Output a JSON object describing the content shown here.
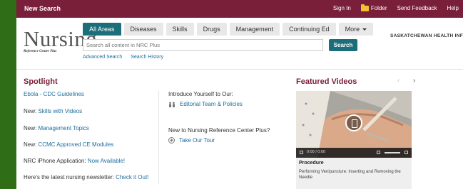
{
  "topbar": {
    "new_search": "New Search",
    "links": [
      "Sign In",
      "Folder",
      "Send Feedback",
      "Help"
    ]
  },
  "logo": {
    "word": "Nursing",
    "sub": "Reference Center Plus"
  },
  "tabs": [
    {
      "label": "All Areas",
      "active": true
    },
    {
      "label": "Diseases",
      "active": false
    },
    {
      "label": "Skills",
      "active": false
    },
    {
      "label": "Drugs",
      "active": false
    },
    {
      "label": "Management",
      "active": false
    },
    {
      "label": "Continuing Ed",
      "active": false
    },
    {
      "label": "More",
      "active": false
    }
  ],
  "search": {
    "placeholder": "Search all content in NRC Plus",
    "button": "Search",
    "advanced": "Advanced Search",
    "history": "Search History"
  },
  "org_name": "SASKATCHEWAN HEALTH INF",
  "spotlight": {
    "title": "Spotlight",
    "items": [
      {
        "prefix": "",
        "link": "Ebola - CDC Guidelines"
      },
      {
        "prefix": "New: ",
        "link": "Skills with Videos"
      },
      {
        "prefix": "New: ",
        "link": "Management Topics"
      },
      {
        "prefix": "New: ",
        "link": "CCMC Approved CE Modules"
      },
      {
        "prefix": "NRC iPhone Application: ",
        "link": "Now Available!"
      },
      {
        "prefix": "Here's the latest nursing newsletter: ",
        "link": "Check it Out!"
      }
    ]
  },
  "intro": {
    "heading": "Introduce Yourself to Our:",
    "team_link": "Editorial Team & Policies",
    "new_heading": "New to Nursing Reference Center Plus?",
    "tour_link": "Take Our Tour"
  },
  "featured": {
    "title": "Featured Videos",
    "prev": "‹",
    "next": "›",
    "time": "0:00 / 0:00",
    "video_category": "Procedure",
    "video_title": "Performing Venipuncture: Inserting and Removing the Needle"
  },
  "colors": {
    "brand": "#7a1f3a",
    "accent": "#1c6e7a",
    "link": "#1c6e9e",
    "strip": "#2f6e16"
  }
}
